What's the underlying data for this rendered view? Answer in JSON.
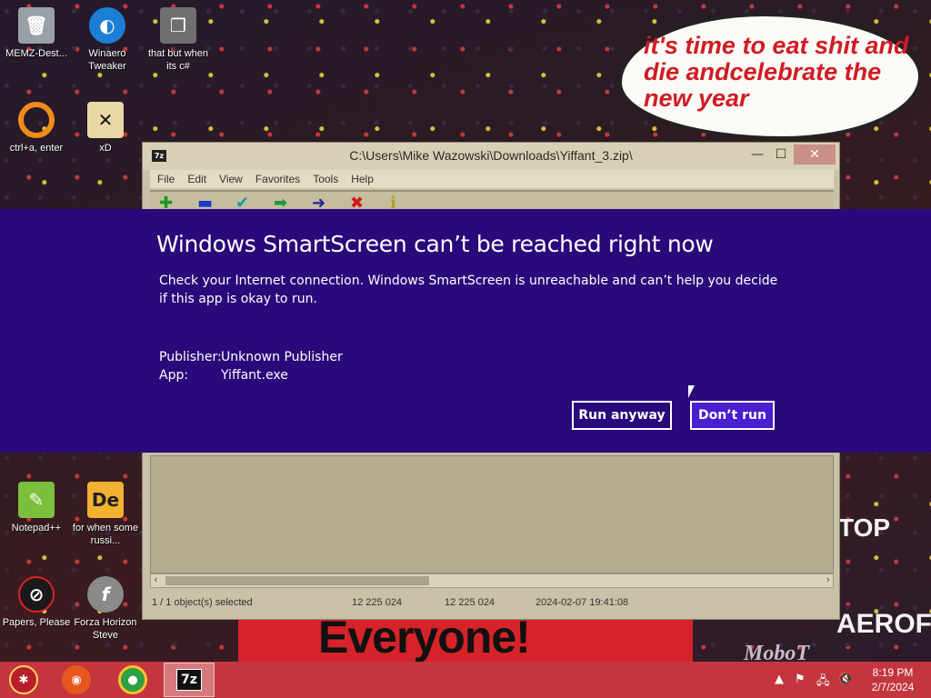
{
  "desktop": {
    "icons": [
      {
        "label": "MEMZ-Dest...",
        "icon": "recycle-bin-icon"
      },
      {
        "label": "Winaero Tweaker",
        "icon": "winaero-icon"
      },
      {
        "label": "that but when its c#",
        "icon": "stack-icon"
      },
      {
        "label": "ctrl+a, enter",
        "icon": "ring-icon"
      },
      {
        "label": "xD",
        "icon": "xd-icon"
      },
      {
        "label": "Notepad++",
        "icon": "notepadpp-icon"
      },
      {
        "label": "for when some russi...",
        "icon": "de-icon"
      },
      {
        "label": "Papers, Please",
        "icon": "papers-please-icon"
      },
      {
        "label": "Forza Horizon Steve",
        "icon": "flash-icon"
      }
    ],
    "meme_text": "it's time to eat shit and die andcelebrate the new year",
    "poster_text": "Everyone!",
    "sign_aero": "AEROFOS",
    "sign_topb": "TOP",
    "sign_mobot": "MoboT"
  },
  "zip_window": {
    "app_icon_text": "7z",
    "title": "C:\\Users\\Mike Wazowski\\Downloads\\Yiffant_3.zip\\",
    "controls": {
      "minimize": "—",
      "maximize": "☐",
      "close": "✕"
    },
    "menu": [
      "File",
      "Edit",
      "View",
      "Favorites",
      "Tools",
      "Help"
    ],
    "status": {
      "selected": "1 / 1 object(s) selected",
      "size": "12 225 024",
      "packed": "12 225 024",
      "modified": "2024-02-07 19:41:08"
    }
  },
  "smartscreen": {
    "title": "Windows SmartScreen can’t be reached right now",
    "message": "Check your Internet connection. Windows SmartScreen is unreachable and can’t help you decide if this app is okay to run.",
    "publisher_label": "Publisher:",
    "publisher_value": "Unknown Publisher",
    "app_label": "App:",
    "app_value": "Yiffant.exe",
    "run_anyway_label": "Run anyway",
    "dont_run_label": "Don’t run",
    "accent_color": "#2a0a7a"
  },
  "taskbar": {
    "zip_label": "7z",
    "clock_time": "8:19 PM",
    "clock_date": "2/7/2024",
    "color": "#c4363e"
  }
}
